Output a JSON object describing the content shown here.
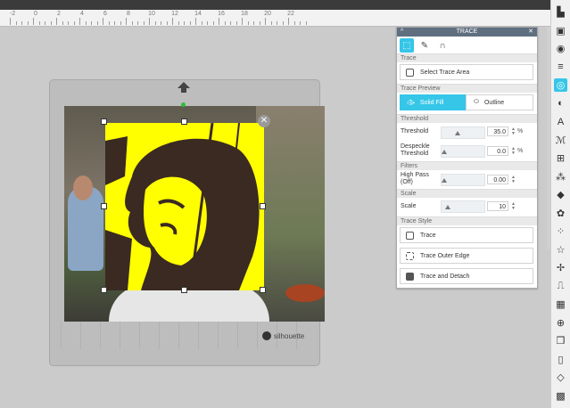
{
  "ruler": {
    "labels": [
      "-2",
      "0",
      "2",
      "4",
      "6",
      "8",
      "10",
      "12",
      "14",
      "16",
      "18",
      "20",
      "22"
    ]
  },
  "canvas": {
    "mat_brand": "silhouette",
    "close_glyph": "✕"
  },
  "panel": {
    "title": "TRACE",
    "caret": "^",
    "close_glyph": "✕",
    "tools": [
      {
        "name": "trace-tool-icon",
        "glyph": "⬚",
        "active": true
      },
      {
        "name": "eyedropper-icon",
        "glyph": "✎",
        "active": false
      },
      {
        "name": "magnet-icon",
        "glyph": "∩",
        "active": false
      }
    ],
    "sections": {
      "trace": "Trace",
      "preview": "Trace Preview",
      "threshold": "Threshold",
      "filters": "Filters",
      "scale": "Scale",
      "style": "Trace Style"
    },
    "select_area_label": "Select Trace Area",
    "preview": {
      "solid": "Solid Fill",
      "outline": "Outline"
    },
    "threshold": {
      "label": "Threshold",
      "value": "35.0",
      "unit": "%",
      "level": 0.35
    },
    "despeckle": {
      "label_line1": "Despeckle",
      "label_line2": "Threshold",
      "value": "0.0",
      "unit": "%",
      "level": 0.0
    },
    "highpass": {
      "label_line1": "High Pass",
      "label_line2": "(Off)",
      "value": "0.00",
      "level": 0.0
    },
    "scale": {
      "label": "Scale",
      "value": "10",
      "level": 0.1
    },
    "style_buttons": {
      "trace": "Trace",
      "outer": "Trace Outer Edge",
      "detach": "Trace and Detach"
    }
  },
  "rightbar": {
    "icons": [
      {
        "name": "page-setup-icon",
        "glyph": "▙"
      },
      {
        "name": "pixscan-icon",
        "glyph": "▣"
      },
      {
        "name": "fill-color-icon",
        "glyph": "◉"
      },
      {
        "name": "line-style-icon",
        "glyph": "≡"
      },
      {
        "name": "trace-panel-icon",
        "glyph": "◎"
      },
      {
        "name": "offset-icon",
        "glyph": "◐"
      },
      {
        "name": "text-style-icon",
        "glyph": "A"
      },
      {
        "name": "sketch-icon",
        "glyph": "ℳ"
      },
      {
        "name": "align-icon",
        "glyph": "⊞"
      },
      {
        "name": "replicate-icon",
        "glyph": "⁂"
      },
      {
        "name": "modify-icon",
        "glyph": "◆"
      },
      {
        "name": "library-icon",
        "glyph": "✿"
      },
      {
        "name": "rhinestone-icon",
        "glyph": "⁘"
      },
      {
        "name": "star-icon",
        "glyph": "☆"
      },
      {
        "name": "puzzle-icon",
        "glyph": "✢"
      },
      {
        "name": "transform-icon",
        "glyph": "⎍"
      },
      {
        "name": "pattern-icon",
        "glyph": "▦"
      },
      {
        "name": "send-icon",
        "glyph": "⊕"
      },
      {
        "name": "layers-icon",
        "glyph": "❒"
      },
      {
        "name": "store-icon",
        "glyph": "▯"
      },
      {
        "name": "fold-icon",
        "glyph": "◇"
      },
      {
        "name": "warp-icon",
        "glyph": "▩"
      }
    ]
  },
  "colors": {
    "accent": "#35c6e8",
    "trace_fill": "#ffff00",
    "titlebar": "#5f6f80"
  }
}
